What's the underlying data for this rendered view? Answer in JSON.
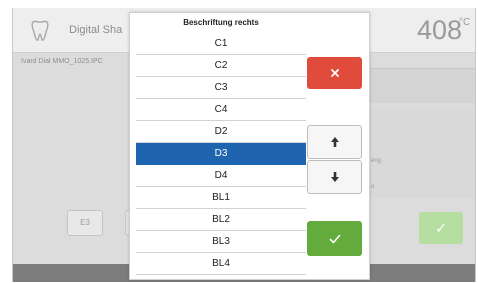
{
  "background": {
    "title": "Digital Sha",
    "temperature": "408",
    "temperature_unit": "°C",
    "file_label": "Ivard Dial MMO_1025.IPC",
    "button_e3": "E3",
    "hint_line_1": "eng",
    "hint_line_2": "o"
  },
  "dialog": {
    "title": "Beschriftung rechts",
    "items": [
      "C1",
      "C2",
      "C3",
      "C4",
      "D2",
      "D3",
      "D4",
      "BL1",
      "BL2",
      "BL3",
      "BL4"
    ],
    "selected": "D3"
  },
  "colors": {
    "cancel": "#e04b3b",
    "confirm": "#62ab3c",
    "selection": "#1f64ae",
    "confirm_disabled": "#b6dea0"
  },
  "icons": {
    "cancel": "close-icon",
    "up": "arrow-up-icon",
    "down": "arrow-down-icon",
    "confirm": "checkmark-icon",
    "app": "tooth-icon"
  }
}
